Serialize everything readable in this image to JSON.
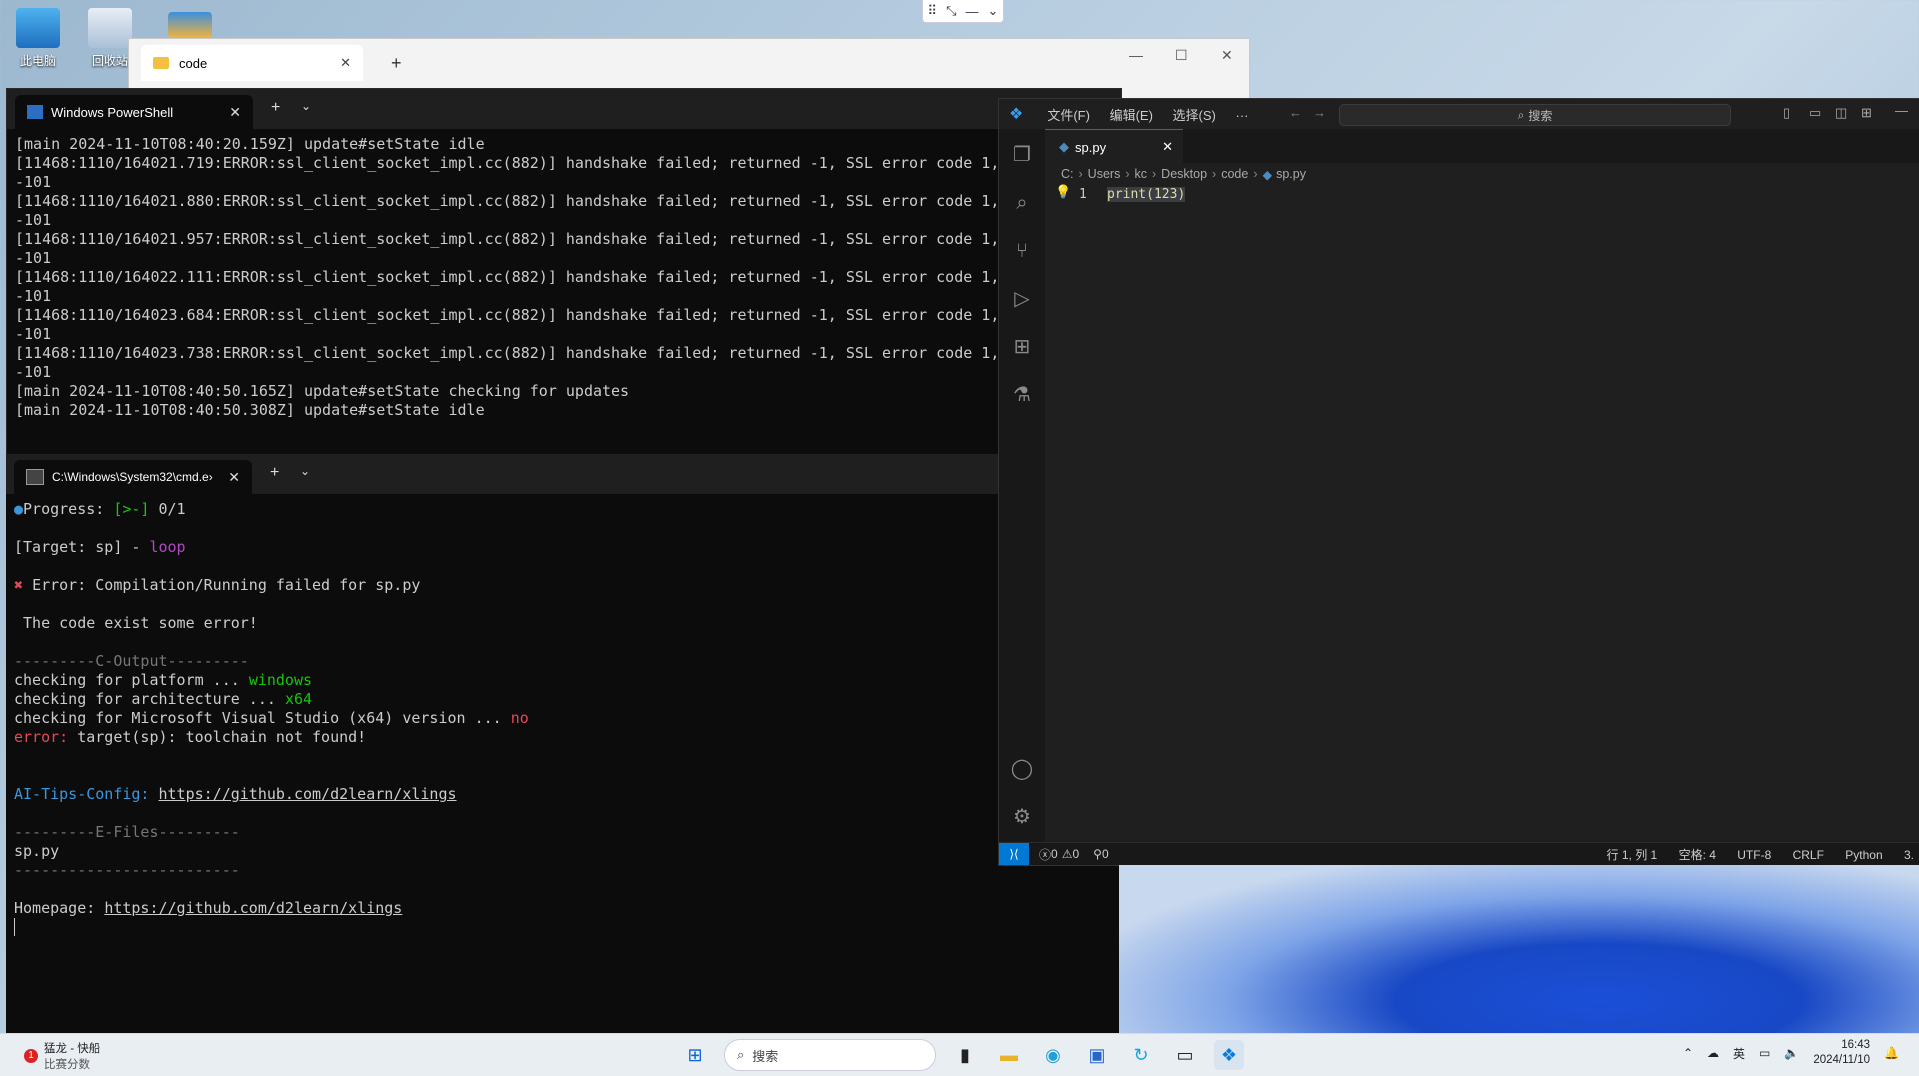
{
  "desktop": {
    "icons": [
      {
        "label": "此电脑"
      },
      {
        "label": "回收站"
      }
    ]
  },
  "explorer": {
    "tab_title": "code",
    "close_glyph": "✕",
    "new_tab_glyph": "+"
  },
  "powershell": {
    "tab_title": "Windows PowerShell",
    "lines": [
      "[main 2024-11-10T08:40:20.159Z] update#setState idle",
      "[11468:1110/164021.719:ERROR:ssl_client_socket_impl.cc(882)] handshake failed; returned -1, SSL error code 1,",
      "-101",
      "[11468:1110/164021.880:ERROR:ssl_client_socket_impl.cc(882)] handshake failed; returned -1, SSL error code 1,",
      "-101",
      "[11468:1110/164021.957:ERROR:ssl_client_socket_impl.cc(882)] handshake failed; returned -1, SSL error code 1,",
      "-101",
      "[11468:1110/164022.111:ERROR:ssl_client_socket_impl.cc(882)] handshake failed; returned -1, SSL error code 1,",
      "-101",
      "[11468:1110/164023.684:ERROR:ssl_client_socket_impl.cc(882)] handshake failed; returned -1, SSL error code 1,",
      "-101",
      "[11468:1110/164023.738:ERROR:ssl_client_socket_impl.cc(882)] handshake failed; returned -1, SSL error code 1,",
      "-101",
      "[main 2024-11-10T08:40:50.165Z] update#setState checking for updates",
      "[main 2024-11-10T08:40:50.308Z] update#setState idle"
    ]
  },
  "cmd": {
    "tab_title": "C:\\Windows\\System32\\cmd.e›",
    "progress_label": "Progress: ",
    "progress_bar": "[>-]",
    "progress_count": " 0/1",
    "target_prefix": "[Target: sp] - ",
    "target_mode": "loop",
    "error_line": "Error: Compilation/Running failed for sp.py",
    "code_error": " The code exist some error!",
    "c_output_header": "---------C-Output---------",
    "check_platform": "checking for platform ... ",
    "check_platform_val": "windows",
    "check_arch": "checking for architecture ... ",
    "check_arch_val": "x64",
    "check_vs": "checking for Microsoft Visual Studio (x64) version ... ",
    "check_vs_val": "no",
    "error_label": "error:",
    "error_msg": " target(sp): toolchain not found!",
    "ai_tips_label": "AI-Tips-Config: ",
    "ai_tips_url": "https://github.com/d2learn/xlings",
    "e_files_header": "---------E-Files---------",
    "e_file": "sp.py",
    "e_files_footer": "-------------------------",
    "homepage_label": "Homepage: ",
    "homepage_url": "https://github.com/d2learn/xlings"
  },
  "vscode": {
    "menu": [
      "文件(F)",
      "编辑(E)",
      "选择(S)",
      "···"
    ],
    "search_placeholder": "搜索",
    "tab_name": "sp.py",
    "breadcrumb": [
      "C:",
      "Users",
      "kc",
      "Desktop",
      "code",
      "sp.py"
    ],
    "line_number": "1",
    "code_line": "print(123)",
    "status": {
      "errors": "0",
      "warnings": "0",
      "ports": "0",
      "position": "行 1, 列 1",
      "spaces": "空格: 4",
      "encoding": "UTF-8",
      "eol": "CRLF",
      "language": "Python",
      "extra": "3."
    }
  },
  "taskbar": {
    "widget_badge": "1",
    "widget_title": "猛龙 - 快船",
    "widget_subtitle": "比赛分数",
    "search_placeholder": "搜索",
    "ime": "英",
    "time": "16:43",
    "date": "2024/11/10"
  }
}
